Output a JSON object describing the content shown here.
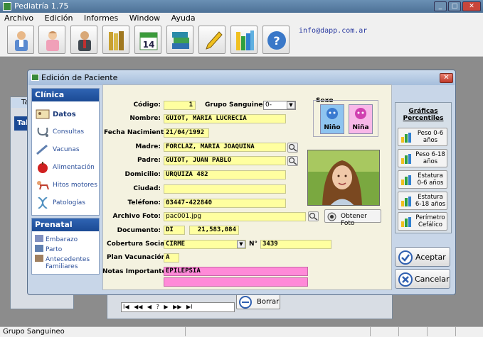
{
  "app": {
    "title": "Pediatría 1.75",
    "email": "info@dapp.com.ar"
  },
  "menu": [
    "Archivo",
    "Edición",
    "Informes",
    "Window",
    "Ayuda"
  ],
  "toolbar_icons": [
    "doctor-icon",
    "nurse-icon",
    "patient-icon",
    "books-icon",
    "calendar-icon",
    "book-stack-icon",
    "pencil-icon",
    "chart-icon",
    "help-icon"
  ],
  "calendar_day": "14",
  "status": {
    "text": "Grupo Sanguineo"
  },
  "bg": {
    "left_title": "Ta",
    "left_tab": "Tab"
  },
  "nav_buttons": [
    "I◀",
    "◀◀",
    "◀",
    "?",
    "▶",
    "▶▶",
    "▶I"
  ],
  "borrar_label": "Borrar",
  "dialog": {
    "title": "Edición de Paciente",
    "clinica": {
      "header": "Clínica",
      "items": [
        "Datos",
        "Consultas",
        "Vacunas",
        "Alimentación",
        "Hitos motores",
        "Patologías"
      ]
    },
    "prenatal": {
      "header": "Prenatal",
      "items": [
        "Embarazo",
        "Parto",
        "Antecedentes Familiares"
      ]
    },
    "form": {
      "codigo_label": "Código:",
      "codigo": "1",
      "grupo_label": "Grupo Sanguineo:",
      "grupo": "0-",
      "sexo_label": "Sexo",
      "nino": "Niño",
      "nina": "Niña",
      "nombre_label": "Nombre:",
      "nombre": "GUIOT, MARIA LUCRECIA",
      "fecha_label": "Fecha Nacimiento:",
      "fecha": "21/04/1992",
      "madre_label": "Madre:",
      "madre": "FORCLAZ, MARIA JOAQUINA",
      "padre_label": "Padre:",
      "padre": "GUIOT, JUAN PABLO",
      "domicilio_label": "Domicilio:",
      "domicilio": "URQUIZA 482",
      "ciudad_label": "Ciudad:",
      "ciudad": "",
      "telefono_label": "Teléfono:",
      "telefono": "03447-422840",
      "archivo_label": "Archivo Foto:",
      "archivo": "pac001.jpg",
      "obtener_label": "Obtener Foto",
      "documento_label": "Documento:",
      "doc_tipo": "DI",
      "doc_num": "21,583,084",
      "cobertura_label": "Cobertura Social:",
      "cobertura": "CIRME",
      "nro_label": "N°",
      "nro": "3439",
      "plan_label": "Plan Vacunación:",
      "plan": "A",
      "notas_label": "Notas Importantes:",
      "notas1": "EPILEPSIA",
      "notas2": ""
    },
    "graficas": {
      "header": "Gráficas Percentiles",
      "buttons": [
        "Peso 0-6 años",
        "Peso 6-18 años",
        "Estatura 0-6 años",
        "Estatura 6-18 años",
        "Perímetro Cefálico"
      ]
    },
    "aceptar": "Aceptar",
    "cancelar": "Cancelar"
  },
  "colors": {
    "field_yellow": "#ffffa0",
    "field_pink": "#ff8ad8",
    "nav_blue": "#1b4a94"
  }
}
